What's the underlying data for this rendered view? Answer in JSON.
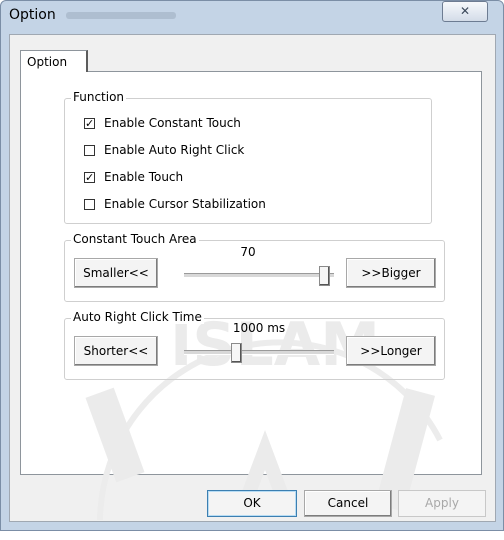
{
  "window": {
    "title": "Option",
    "close_glyph": "✕"
  },
  "tabs": [
    {
      "label": "Option",
      "selected": true
    }
  ],
  "function_group": {
    "title": "Function",
    "items": [
      {
        "label": "Enable Constant Touch",
        "checked": true
      },
      {
        "label": "Enable Auto Right Click",
        "checked": false
      },
      {
        "label": "Enable Touch",
        "checked": true
      },
      {
        "label": "Enable Cursor Stabilization",
        "checked": false
      }
    ]
  },
  "constant_touch": {
    "title": "Constant Touch Area",
    "value_label": "70",
    "level_fraction": 0.97,
    "decrease_label": "Smaller<<",
    "increase_label": ">>Bigger"
  },
  "auto_right_click": {
    "title": "Auto Right Click Time",
    "value_label": "1000 ms",
    "level_fraction": 0.34,
    "decrease_label": "Shorter<<",
    "increase_label": ">>Longer"
  },
  "footer": {
    "ok_label": "OK",
    "cancel_label": "Cancel",
    "apply_label": "Apply",
    "apply_enabled": false
  },
  "colors": {
    "frame": "#c4d4e6",
    "client": "#f0f0f0",
    "panel": "#ffffff",
    "disabled_text": "#a8a8a8"
  },
  "watermark_text": "ISLAM"
}
